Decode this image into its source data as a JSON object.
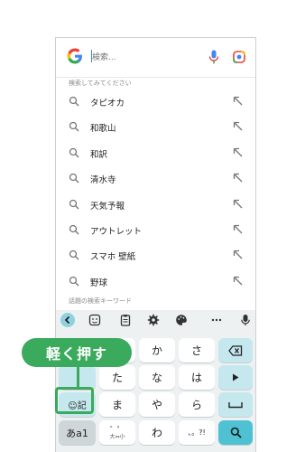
{
  "search": {
    "placeholder": "検索..."
  },
  "section_try": "検索してみてください",
  "suggestions": [
    "タピオカ",
    "和歌山",
    "和訳",
    "清水寺",
    "天気予報",
    "アウトレット",
    "スマホ 壁紙",
    "野球"
  ],
  "section_trending": "話題の検索キーワード",
  "keyboard": {
    "row1": [
      "か",
      "さ"
    ],
    "row2": [
      "た",
      "な",
      "は"
    ],
    "row3": [
      "ま",
      "や",
      "ら"
    ],
    "row4_wa": "わ",
    "emoji_key": "☺記",
    "kana_key": "あa1",
    "dakuten_key": "゛゜",
    "dakuten_sub": "大⇔小",
    "punct_key": "、。?!",
    "left_key_glyph": "←"
  },
  "callout": {
    "text": "軽く押す"
  },
  "colors": {
    "accent": "#4ec2d2",
    "callout": "#3aaa5c",
    "google_blue": "#4285F4"
  }
}
